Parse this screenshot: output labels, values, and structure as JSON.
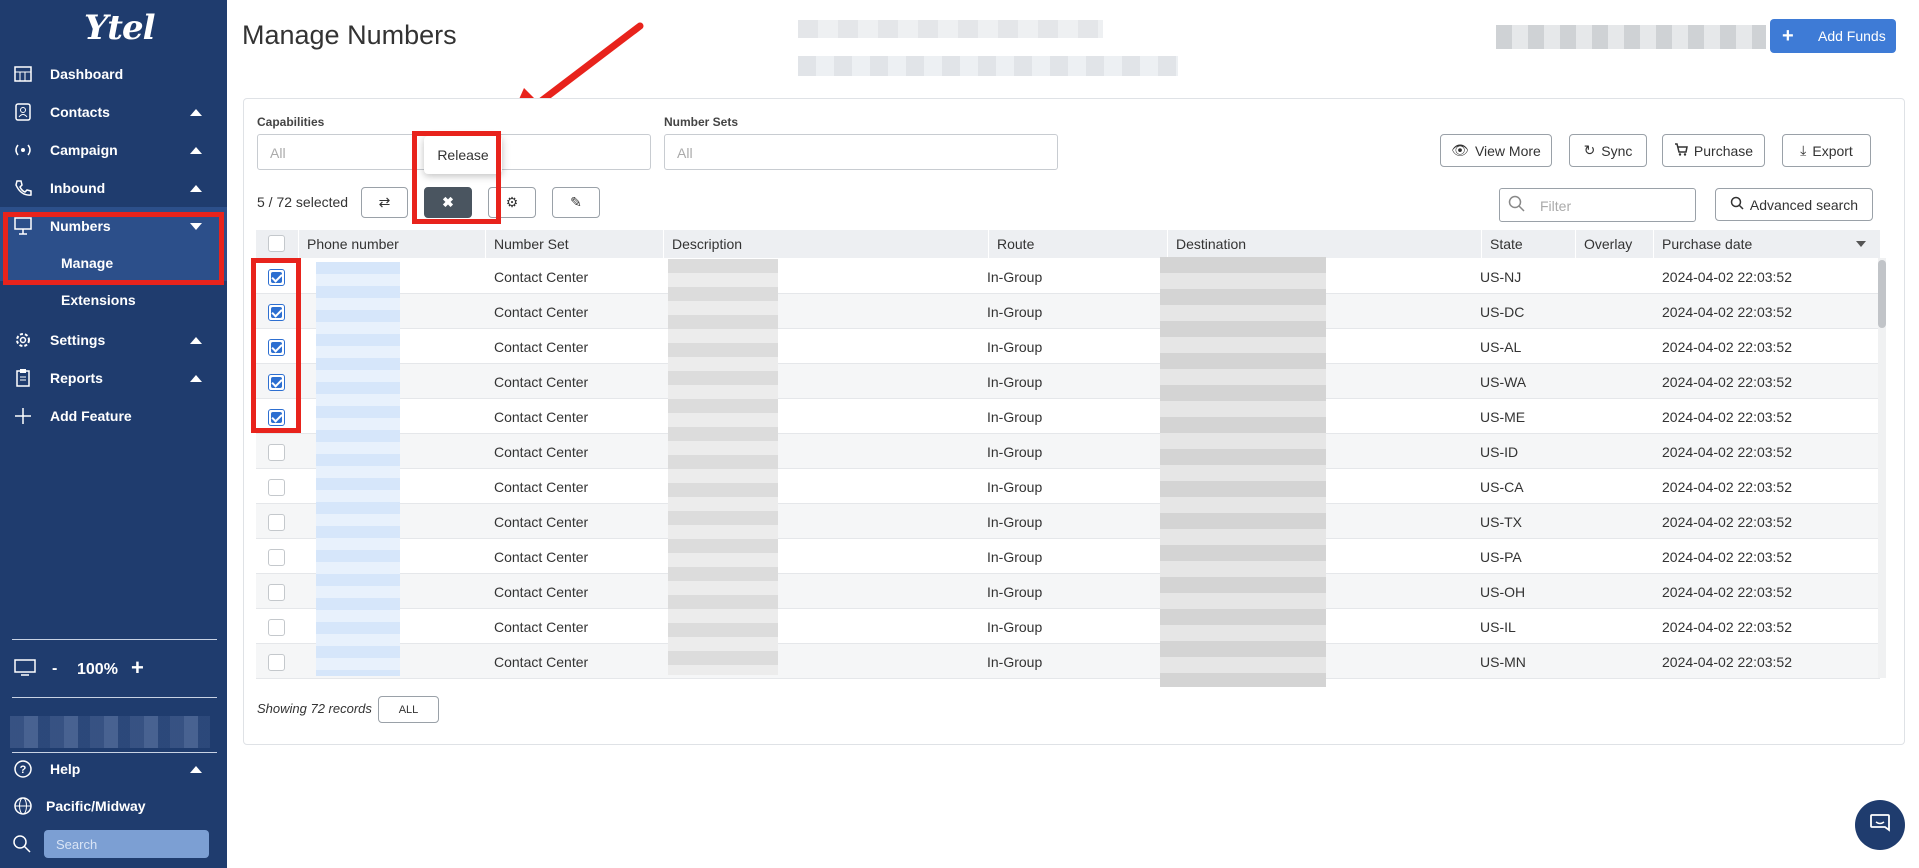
{
  "app": {
    "logo": "Ytel",
    "page_title": "Manage Numbers"
  },
  "sidebar": {
    "items": [
      {
        "label": "Dashboard",
        "icon": "dashboard-icon",
        "caret": ""
      },
      {
        "label": "Contacts",
        "icon": "contacts-icon",
        "caret": "up"
      },
      {
        "label": "Campaign",
        "icon": "campaign-icon",
        "caret": "up"
      },
      {
        "label": "Inbound",
        "icon": "inbound-icon",
        "caret": "up"
      },
      {
        "label": "Numbers",
        "icon": "numbers-icon",
        "caret": "down"
      }
    ],
    "sub_items": [
      {
        "label": "Manage",
        "active": true
      },
      {
        "label": "Extensions",
        "active": false
      }
    ],
    "lower_items": [
      {
        "label": "Settings",
        "icon": "gear-icon"
      },
      {
        "label": "Reports",
        "icon": "clipboard-icon"
      },
      {
        "label": "Add Feature",
        "icon": "plus-icon"
      }
    ],
    "zoom": {
      "minus": "-",
      "value": "100%",
      "plus": "+"
    },
    "help": "Help",
    "timezone": "Pacific/Midway",
    "search_placeholder": "Search"
  },
  "header": {
    "add_funds": "Add Funds"
  },
  "filters": {
    "capabilities_label": "Capabilities",
    "capabilities_value": "All",
    "number_sets_label": "Number Sets",
    "number_sets_value": "All",
    "view_more": "View More",
    "sync": "Sync",
    "purchase": "Purchase",
    "export": "Export",
    "filter_placeholder": "Filter",
    "advanced_search": "Advanced search"
  },
  "toolbar": {
    "selected_count": "5 / 72 selected",
    "release_tooltip": "Release"
  },
  "table": {
    "columns": [
      "Phone number",
      "Number Set",
      "Description",
      "Route",
      "Destination",
      "State",
      "Overlay",
      "Purchase date"
    ],
    "rows": [
      {
        "checked": true,
        "number_set": "Contact Center",
        "route": "In-Group",
        "state": "US-NJ",
        "date": "2024-04-02 22:03:52"
      },
      {
        "checked": true,
        "number_set": "Contact Center",
        "route": "In-Group",
        "state": "US-DC",
        "date": "2024-04-02 22:03:52"
      },
      {
        "checked": true,
        "number_set": "Contact Center",
        "route": "In-Group",
        "state": "US-AL",
        "date": "2024-04-02 22:03:52"
      },
      {
        "checked": true,
        "number_set": "Contact Center",
        "route": "In-Group",
        "state": "US-WA",
        "date": "2024-04-02 22:03:52"
      },
      {
        "checked": true,
        "number_set": "Contact Center",
        "route": "In-Group",
        "state": "US-ME",
        "date": "2024-04-02 22:03:52"
      },
      {
        "checked": false,
        "number_set": "Contact Center",
        "route": "In-Group",
        "state": "US-ID",
        "date": "2024-04-02 22:03:52"
      },
      {
        "checked": false,
        "number_set": "Contact Center",
        "route": "In-Group",
        "state": "US-CA",
        "date": "2024-04-02 22:03:52"
      },
      {
        "checked": false,
        "number_set": "Contact Center",
        "route": "In-Group",
        "state": "US-TX",
        "date": "2024-04-02 22:03:52"
      },
      {
        "checked": false,
        "number_set": "Contact Center",
        "route": "In-Group",
        "state": "US-PA",
        "date": "2024-04-02 22:03:52"
      },
      {
        "checked": false,
        "number_set": "Contact Center",
        "route": "In-Group",
        "state": "US-OH",
        "date": "2024-04-02 22:03:52"
      },
      {
        "checked": false,
        "number_set": "Contact Center",
        "route": "In-Group",
        "state": "US-IL",
        "date": "2024-04-02 22:03:52"
      },
      {
        "checked": false,
        "number_set": "Contact Center",
        "route": "In-Group",
        "state": "US-MN",
        "date": "2024-04-02 22:03:52"
      }
    ]
  },
  "footer": {
    "showing": "Showing 72 records",
    "all_button": "ALL"
  },
  "colors": {
    "sidebar": "#1f3c6e",
    "accent": "#3e7bd6",
    "annotation": "#e8231c"
  }
}
